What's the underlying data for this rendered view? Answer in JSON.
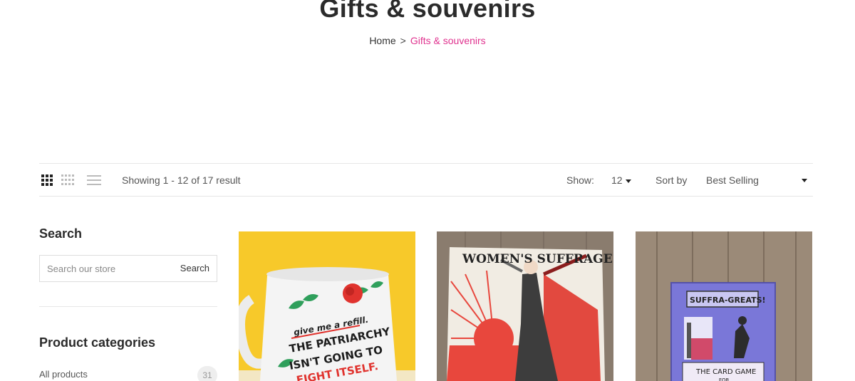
{
  "page": {
    "title": "Gifts & souvenirs"
  },
  "breadcrumb": {
    "home": "Home",
    "separator": ">",
    "current": "Gifts & souvenirs"
  },
  "toolbar": {
    "views": [
      "grid-3-icon",
      "grid-4-icon",
      "list-icon"
    ],
    "result_count": "Showing 1 - 12 of 17 result",
    "show_label": "Show:",
    "show_value": "12",
    "sort_label": "Sort by",
    "sort_value": "Best Selling"
  },
  "sidebar": {
    "search_title": "Search",
    "search_placeholder": "Search our store",
    "search_button": "Search",
    "categories_title": "Product categories",
    "categories": [
      {
        "label": "All products",
        "count": "31"
      }
    ]
  },
  "products": [
    {
      "image": "mug-patriarchy-photo",
      "mug_text": "give me a refill. THE PATRIARCHY ISN'T GOING TO FIGHT ITSELF."
    },
    {
      "image": "womens-suffrage-tea-towel-photo",
      "banner_text": "WOMEN'S SUFFRAGE"
    },
    {
      "image": "suffra-greats-card-game-photo",
      "box_title": "SUFFRA-GREATS!",
      "box_subtitle": "THE CARD GAME",
      "box_subtitle_2": "FOR"
    }
  ],
  "colors": {
    "accent": "#e0338f",
    "border": "#e6e6e6",
    "title": "#2b2b2b"
  }
}
